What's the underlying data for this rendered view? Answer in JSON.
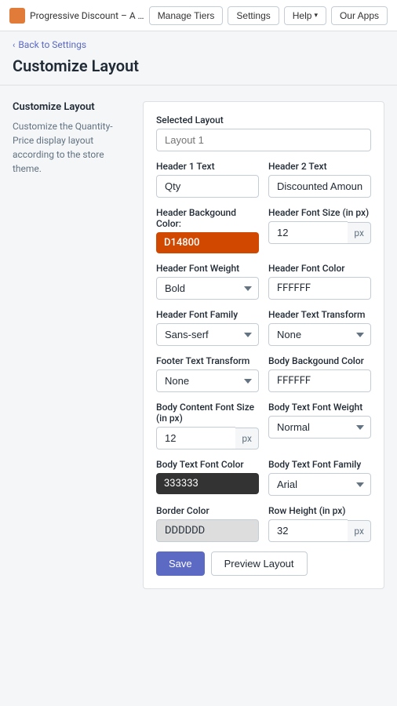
{
  "topNav": {
    "appTitle": "Progressive Discount – A Tiered Discount app...",
    "manageTiers": "Manage Tiers",
    "settings": "Settings",
    "help": "Help",
    "ourApps": "Our Apps"
  },
  "backLink": "Back to Settings",
  "pageTitle": "Customize Layout",
  "leftPanel": {
    "title": "Customize Layout",
    "description": "Customize the Quantity-Price display layout according to the store theme."
  },
  "form": {
    "selectedLayout": {
      "label": "Selected Layout",
      "placeholder": "Layout 1"
    },
    "header1Text": {
      "label": "Header 1 Text",
      "value": "Qty"
    },
    "header2Text": {
      "label": "Header 2 Text",
      "value": "Discounted Amount"
    },
    "headerBgColor": {
      "label": "Header Backgound Color:",
      "value": "D14800"
    },
    "headerFontSize": {
      "label": "Header Font Size (in px)",
      "value": "12",
      "unit": "px"
    },
    "headerFontWeight": {
      "label": "Header Font Weight",
      "value": "Bold"
    },
    "headerFontColor": {
      "label": "Header Font Color",
      "value": "FFFFFF"
    },
    "headerFontFamily": {
      "label": "Header Font Family",
      "value": "Sans-serf"
    },
    "headerTextTransform": {
      "label": "Header Text Transform",
      "value": "None"
    },
    "footerTextTransform": {
      "label": "Footer Text Transform",
      "value": "None"
    },
    "bodyBgColor": {
      "label": "Body Backgound Color",
      "value": "FFFFFF"
    },
    "bodyContentFontSize": {
      "label": "Body Content Font Size (in px)",
      "value": "12",
      "unit": "px"
    },
    "bodyTextFontWeight": {
      "label": "Body Text Font Weight",
      "value": "Normal"
    },
    "bodyTextFontColor": {
      "label": "Body Text Font Color",
      "value": "333333"
    },
    "bodyTextFontFamily": {
      "label": "Body Text Font Family",
      "value": "Arial"
    },
    "borderColor": {
      "label": "Border Color",
      "value": "DDDDDD"
    },
    "rowHeight": {
      "label": "Row Height (in px)",
      "value": "32",
      "unit": "px"
    },
    "saveBtn": "Save",
    "previewBtn": "Preview Layout"
  }
}
